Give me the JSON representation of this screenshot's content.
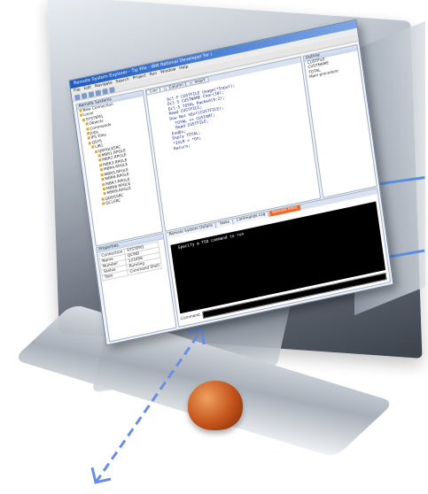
{
  "window": {
    "title": "Remote System Explorer - Tip File - IBM Rational Developer for i",
    "menu": [
      "File",
      "Edit",
      "Navigate",
      "Search",
      "Project",
      "Run",
      "Window",
      "Help"
    ]
  },
  "left_panel": {
    "title": "Remote Systems",
    "items": [
      "New Connection",
      "Local",
      "SYSTEM1",
      "Objects",
      "Commands",
      "Jobs",
      "IFS Files",
      "QSYS",
      "LIB1",
      "QRPGLESRC",
      "MBR1.RPGLE",
      "MBR2.RPGLE",
      "MBR3.RPGLE",
      "MBR4.RPGLE",
      "MBR5.RPGLE",
      "MBR6.RPGLE",
      "MBR7.RPGLE",
      "MBR8.RPGLE",
      "MBR9.RPGLE",
      "QDDSSRC",
      "QCLSRC"
    ]
  },
  "editor": {
    "tabs": [
      "Line 1",
      "Column 1",
      "Insert"
    ],
    "lines": [
      "       Dcl-F CUSTFILE Usage(*Input);",
      "       Dcl-S CUSTNAME Char(30);",
      "       Dcl-S TOTAL Packed(9:2);",
      "",
      "       Read CUSTFILE;",
      "       Dow Not %Eof(CUSTFILE);",
      "         TOTAL += CUSTAMT;",
      "         Read CUSTFILE;",
      "       EndDo;",
      "",
      "       Dsply TOTAL;",
      "       *InLR = *On;",
      "       Return;"
    ]
  },
  "outline": {
    "title": "Outline",
    "items": [
      "CUSTFILE",
      "CUSTNAME",
      "TOTAL",
      "Main procedure"
    ]
  },
  "properties": {
    "title": "Properties",
    "rows": [
      [
        "Connection",
        "SYSTEM1"
      ],
      [
        "Name",
        "QCMD"
      ],
      [
        "Number",
        "123456"
      ],
      [
        "Status",
        "Running"
      ],
      [
        "Type",
        "Command Shell"
      ]
    ]
  },
  "console": {
    "tabs": [
      "Remote System Details",
      "Tasks",
      "Commands Log",
      "Remote Shell"
    ],
    "active_tab": "Remote Shell",
    "output": "Specify a TSO command to run",
    "command_label": "Command"
  }
}
